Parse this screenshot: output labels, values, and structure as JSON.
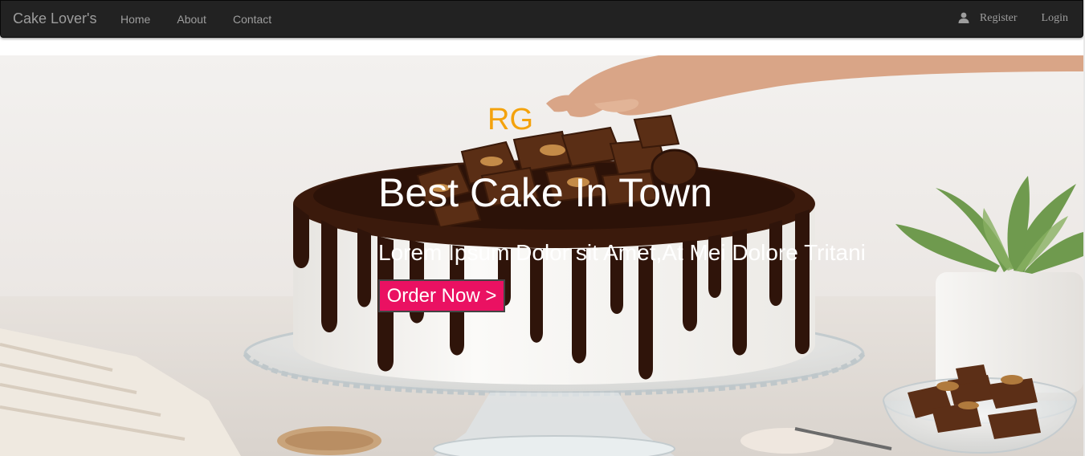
{
  "navbar": {
    "brand": "Cake Lover's",
    "links": [
      "Home",
      "About",
      "Contact"
    ],
    "register_label": "Register",
    "login_label": "Login",
    "background": "#222222",
    "link_color": "#9d9d9d"
  },
  "hero": {
    "logo_text": "RG",
    "logo_color": "#f4a20c",
    "headline": "Best Cake In Town",
    "subtitle": "Lorem Ipsum Dolor sit Amet,At Mei Dolore Tritani",
    "cta_label": "Order Now >",
    "cta_color": "#ea1162"
  },
  "icons": {
    "user": "user-icon"
  }
}
